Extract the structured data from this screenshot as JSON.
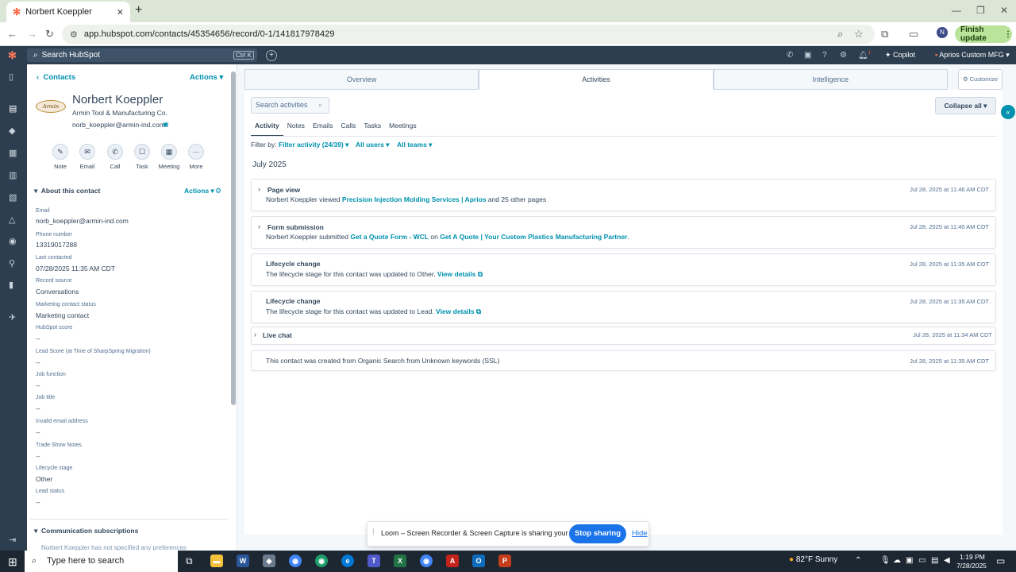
{
  "browser": {
    "tab_title": "Norbert Koeppler",
    "url": "app.hubspot.com/contacts/45354656/record/0-1/141817978429",
    "finish_update": "Finish update",
    "profile_initial": "N"
  },
  "topbar": {
    "search_placeholder": "Search HubSpot",
    "kbd": "Ctrl K",
    "notifications_count": "1",
    "copilot": "Copilot",
    "account": "Aprios Custom MFG"
  },
  "sidebar": {
    "back": "Contacts",
    "actions": "Actions",
    "company_logo_text": "Armin",
    "name": "Norbert Koeppler",
    "company": "Armin Tool & Manufacturing Co.",
    "email": "norb_koeppler@armin-ind.com",
    "quick_actions": [
      "Note",
      "Email",
      "Call",
      "Task",
      "Meeting",
      "More"
    ],
    "about_header": "About this contact",
    "about_actions": "Actions",
    "properties": [
      {
        "label": "Email",
        "value": "norb_koeppler@armin-ind.com"
      },
      {
        "label": "Phone number",
        "value": "13319017288"
      },
      {
        "label": "Last contacted",
        "value": "07/28/2025 11:35 AM CDT"
      },
      {
        "label": "Record source",
        "value": "Conversations"
      },
      {
        "label": "Marketing contact status",
        "value": "Marketing contact"
      },
      {
        "label": "HubSpot score",
        "value": "--"
      },
      {
        "label": "Lead Score (at Time of SharpSpring Migration)",
        "value": "--"
      },
      {
        "label": "Job function",
        "value": "--"
      },
      {
        "label": "Job title",
        "value": "--"
      },
      {
        "label": "Invalid email address",
        "value": "--"
      },
      {
        "label": "Trade Show Notes",
        "value": "--"
      },
      {
        "label": "Lifecycle stage",
        "value": "Other"
      },
      {
        "label": "Lead status",
        "value": "--"
      }
    ],
    "comm_header": "Communication subscriptions",
    "comm_text": "Norbert Koeppler has not specified any preferences"
  },
  "main": {
    "tabs": [
      "Overview",
      "Activities",
      "Intelligence"
    ],
    "customize": "Customize",
    "search_placeholder": "Search activities",
    "collapse_all": "Collapse all",
    "subtabs": [
      "Activity",
      "Notes",
      "Emails",
      "Calls",
      "Tasks",
      "Meetings"
    ],
    "filter_by": "Filter by:",
    "filter_activity": "Filter activity (24/39)",
    "all_users": "All users",
    "all_teams": "All teams",
    "month": "July 2025",
    "cards": [
      {
        "title": "Page view",
        "body_prefix": "Norbert Koeppler viewed ",
        "link1": "Precision Injection Molding Services | Aprios",
        "body_mid": " and 25 other pages",
        "date": "Jul 28, 2025 at 11:46 AM CDT"
      },
      {
        "title": "Form submission",
        "body_prefix": "Norbert Koeppler submitted ",
        "link1": "Get a Quote Form - WCL",
        "body_mid": " on ",
        "link2": "Get A Quote | Your Custom Plastics Manufacturing Partner",
        "body_suffix": ".",
        "date": "Jul 28, 2025 at 11:40 AM CDT"
      },
      {
        "title": "Lifecycle change",
        "body_prefix": "The lifecycle stage for this contact was updated to Other. ",
        "link1": "View details",
        "date": "Jul 28, 2025 at 11:35 AM CDT"
      },
      {
        "title": "Lifecycle change",
        "body_prefix": "The lifecycle stage for this contact was updated to Lead. ",
        "link1": "View details",
        "date": "Jul 28, 2025 at 11:35 AM CDT"
      },
      {
        "title": "Live chat",
        "date": "Jul 28, 2025 at 11:34 AM CDT"
      },
      {
        "body_prefix": "This contact was created from Organic Search from Unknown keywords (SSL)",
        "date": "Jul 28, 2025 at 11:35 AM CDT"
      }
    ]
  },
  "loom": {
    "text": "Loom – Screen Recorder & Screen Capture is sharing your screen.",
    "stop": "Stop sharing",
    "hide": "Hide"
  },
  "taskbar": {
    "search": "Type here to search",
    "weather": "82°F  Sunny",
    "time": "1:19 PM",
    "date": "7/28/2025"
  }
}
